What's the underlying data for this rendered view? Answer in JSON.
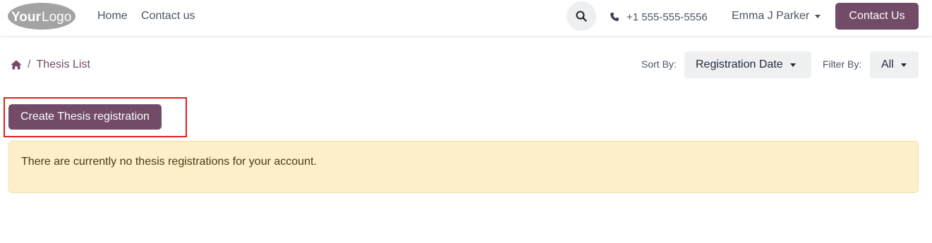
{
  "header": {
    "logo_text": "YourLogo",
    "nav": [
      {
        "label": "Home"
      },
      {
        "label": "Contact us"
      }
    ],
    "phone": "+1 555-555-5556",
    "user_name": "Emma J Parker",
    "contact_button": "Contact Us"
  },
  "breadcrumb": {
    "separator": "/",
    "current": "Thesis List"
  },
  "toolbar": {
    "sort_label": "Sort By:",
    "sort_value": "Registration Date",
    "filter_label": "Filter By:",
    "filter_value": "All"
  },
  "main": {
    "create_button": "Create Thesis registration",
    "empty_message": "There are currently no thesis registrations for your account."
  },
  "colors": {
    "brand": "#714b67",
    "alert_bg": "#fcefca",
    "highlight": "#e02020"
  },
  "icons": [
    "search-icon",
    "phone-icon",
    "home-icon",
    "caret-down-icon"
  ]
}
